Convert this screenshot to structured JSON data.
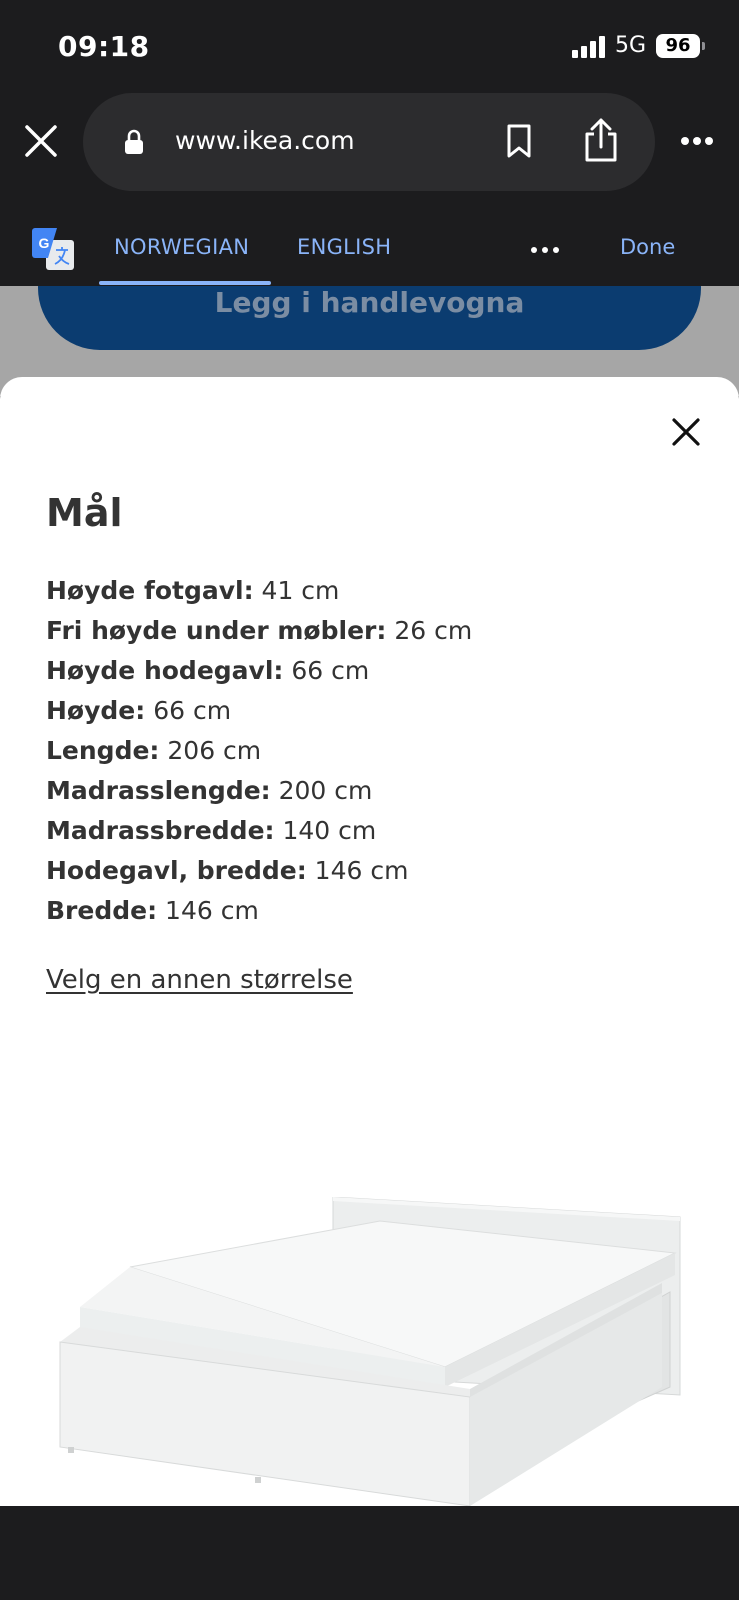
{
  "status_bar": {
    "time": "09:18",
    "network": "5G",
    "battery": "96"
  },
  "browser": {
    "url": "www.ikea.com"
  },
  "translate_bar": {
    "tabs": [
      "NORWEGIAN",
      "ENGLISH"
    ],
    "active_tab": "NORWEGIAN",
    "done_label": "Done"
  },
  "background": {
    "cart_button_label": "Legg i handlevogna"
  },
  "sheet": {
    "title": "Mål",
    "dimensions": [
      {
        "label": "Høyde fotgavl:",
        "value": "41 cm"
      },
      {
        "label": "Fri høyde under møbler:",
        "value": "26 cm"
      },
      {
        "label": "Høyde hodegavl:",
        "value": "66 cm"
      },
      {
        "label": "Høyde:",
        "value": "66 cm"
      },
      {
        "label": "Lengde:",
        "value": "206 cm"
      },
      {
        "label": "Madrasslengde:",
        "value": "200 cm"
      },
      {
        "label": "Madrassbredde:",
        "value": "140 cm"
      },
      {
        "label": "Hodegavl, bredde:",
        "value": "146 cm"
      },
      {
        "label": "Bredde:",
        "value": "146 cm"
      }
    ],
    "size_link": "Velg en annen størrelse"
  },
  "colors": {
    "accent": "#8ab4f8",
    "ikea_blue": "#0b3c70",
    "text": "#333333"
  }
}
